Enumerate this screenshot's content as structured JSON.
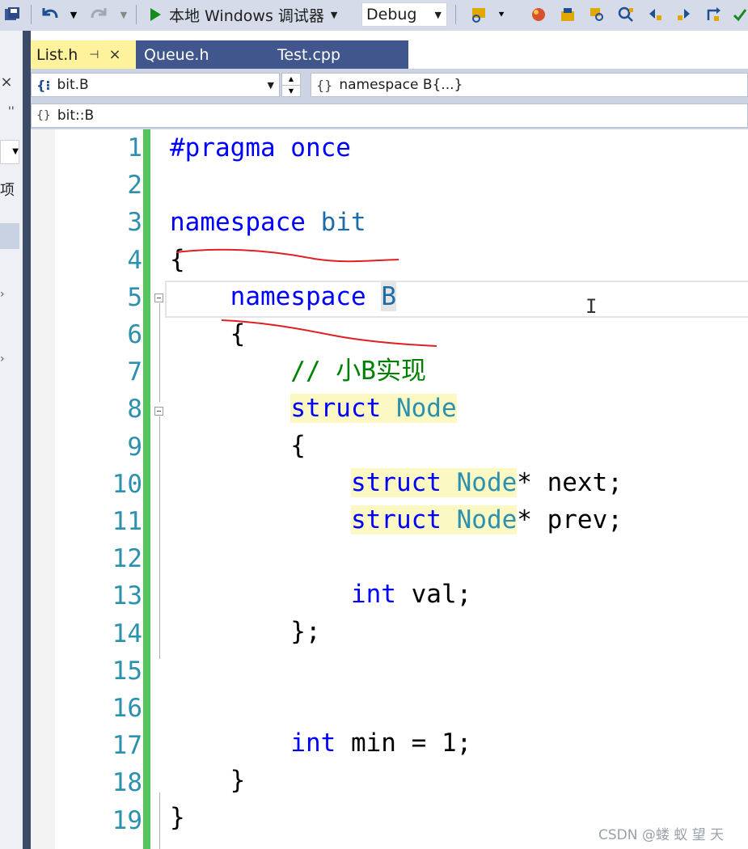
{
  "toolbar": {
    "run_label": "本地 Windows 调试器",
    "configuration": "Debug"
  },
  "left_panel": {
    "close_glyph": "×",
    "label": "项"
  },
  "tabs": [
    {
      "label": "List.h",
      "active": true,
      "pin": "⊣",
      "close": "×"
    },
    {
      "label": "Queue.h",
      "active": false
    },
    {
      "label": "Test.cpp",
      "active": false
    }
  ],
  "navbar": {
    "scope_combo": "bit.B",
    "member_combo": "namespace B{...}",
    "namespace_path": "bit::B"
  },
  "editor": {
    "line_numbers": [
      "1",
      "2",
      "3",
      "4",
      "5",
      "6",
      "7",
      "8",
      "9",
      "10",
      "11",
      "12",
      "13",
      "14",
      "15",
      "16",
      "17",
      "18",
      "19"
    ],
    "lines": [
      "#pragma once",
      "",
      "namespace bit",
      "{",
      "    namespace B",
      "    {",
      "        // 小B实现",
      "        struct Node",
      "        {",
      "            struct Node* next;",
      "            struct Node* prev;",
      "",
      "            int val;",
      "        };",
      "",
      "",
      "        int min = 1;",
      "    }",
      "}"
    ]
  },
  "watermark": "CSDN @蝼 蚁 望 天",
  "colors": {
    "keyword": "#0000ff",
    "type": "#2b91af",
    "comment": "#008000",
    "line_number": "#2b91af",
    "change_bar": "#57c45d",
    "active_tab": "#fff29d",
    "tab_strip": "#40568c"
  }
}
